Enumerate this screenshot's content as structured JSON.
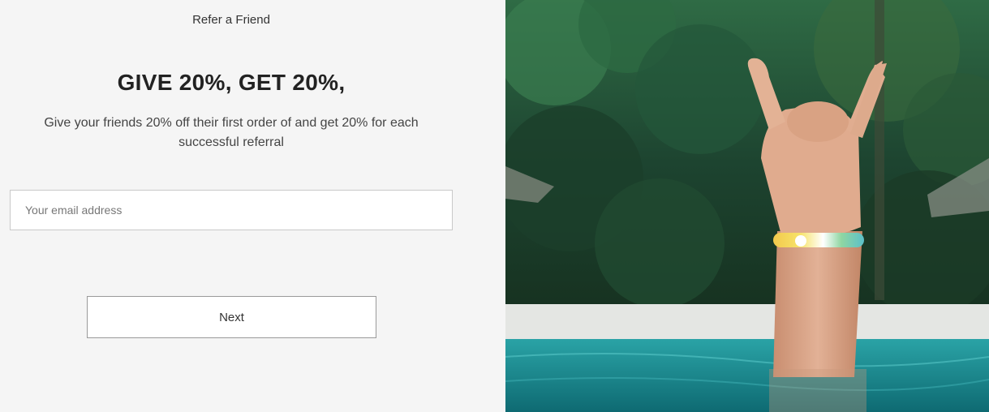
{
  "header": {
    "title": "Refer a Friend"
  },
  "offer": {
    "headline": "GIVE 20%, GET 20%,",
    "description": "Give your friends 20% off their first order of and get 20% for each successful referral"
  },
  "form": {
    "email_placeholder": "Your email address",
    "email_value": "",
    "next_label": "Next"
  },
  "colors": {
    "left_background": "#f5f5f5",
    "water": "#1f8a8e",
    "jungle": "#1e4630"
  }
}
